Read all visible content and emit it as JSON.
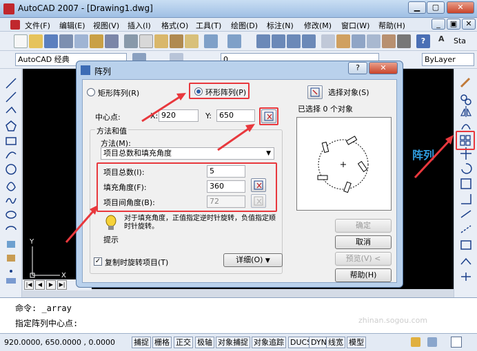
{
  "app": {
    "title": "AutoCAD 2007 - [Drawing1.dwg]"
  },
  "menu": [
    "文件(F)",
    "编辑(E)",
    "视图(V)",
    "插入(I)",
    "格式(O)",
    "工具(T)",
    "绘图(D)",
    "标注(N)",
    "修改(M)",
    "窗口(W)",
    "帮助(H)"
  ],
  "toolbar": {
    "workspace_combo": "AutoCAD 经典",
    "layer_combo": "0",
    "bylayer_combo": "ByLayer",
    "style_text": "Sta"
  },
  "dialog": {
    "title": "阵列",
    "rect_array_label": "矩形阵列(R)",
    "polar_array_label": "环形阵列(P)",
    "select_objects_label": "选择对象(S)",
    "selected_count_text": "已选择 0 个对象",
    "center_point_label": "中心点:",
    "x_label": "X:",
    "x_value": "920",
    "y_label": "Y:",
    "y_value": "650",
    "method_group_label": "方法和值",
    "method_label": "方法(M):",
    "method_value": "项目总数和填充角度",
    "total_items_label": "项目总数(I):",
    "total_items_value": "5",
    "fill_angle_label": "填充角度(F):",
    "fill_angle_value": "360",
    "angle_between_label": "项目间角度(B):",
    "angle_between_value": "72",
    "hint_text": "对于填充角度，正值指定逆时针旋转，负值指定顺时针旋转。",
    "hint_label": "提示",
    "rotate_items_label": "复制时旋转项目(T)",
    "rotate_items_checked": true,
    "details_label": "详细(O)",
    "ok_label": "确定",
    "cancel_label": "取消",
    "preview_label": "预览(V) <",
    "help_label": "帮助(H)"
  },
  "annotation": {
    "array_label": "阵列"
  },
  "layout_tab_buttons": [
    "|◀",
    "◀",
    "▶",
    "▶|"
  ],
  "command": {
    "line1": "命令: _array",
    "line2": "指定阵列中心点:"
  },
  "status": {
    "coords": "920.0000,  650.0000 , 0.0000",
    "toggles": [
      "捕捉",
      "栅格",
      "正交",
      "极轴",
      "对象捕捉",
      "对象追踪",
      "DUCS",
      "DYN",
      "线宽",
      "模型"
    ]
  },
  "watermark": {
    "text": "搜狗指南",
    "sub": "zhinan.sogou.com"
  },
  "colors": {
    "accent_red": "#e8383d",
    "title_blue": "#9fbfe4",
    "canvas": "#000000"
  }
}
